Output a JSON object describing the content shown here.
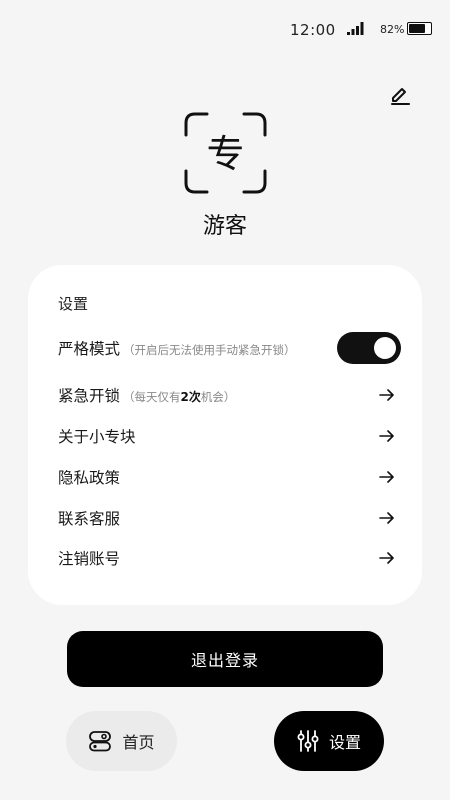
{
  "status_bar": {
    "time": "12:00",
    "battery_percent": "82%",
    "battery_level": 0.82
  },
  "profile": {
    "avatar_glyph": "专",
    "username": "游客"
  },
  "settings": {
    "title": "设置",
    "strict_mode": {
      "label": "严格模式",
      "note": "（开启后无法使用手动紧急开锁）",
      "enabled": true
    },
    "emergency_unlock": {
      "label": "紧急开锁",
      "note_prefix": "（每天仅有",
      "note_count": "2次",
      "note_suffix": "机会）"
    },
    "items": [
      {
        "label": "关于小专块"
      },
      {
        "label": "隐私政策"
      },
      {
        "label": "联系客服"
      },
      {
        "label": "注销账号"
      }
    ]
  },
  "logout_label": "退出登录",
  "nav": {
    "home_label": "首页",
    "settings_label": "设置"
  }
}
